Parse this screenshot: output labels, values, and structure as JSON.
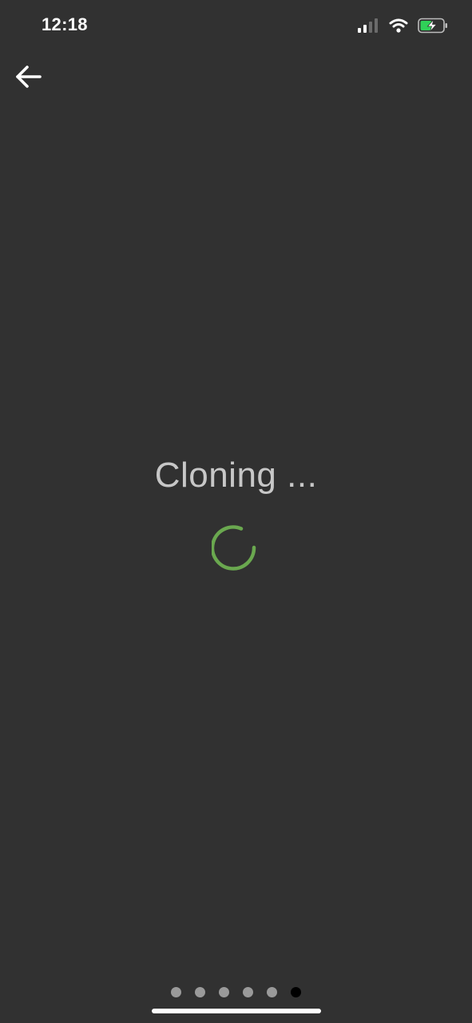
{
  "status_bar": {
    "time": "12:18",
    "icons": [
      "cellular-signal-icon",
      "wifi-icon",
      "battery-charging-icon"
    ],
    "battery_color": "#30d158"
  },
  "nav": {
    "back_icon": "arrow-left-icon"
  },
  "loading": {
    "title": "Cloning ...",
    "spinner_color": "#6aa84f"
  },
  "pager": {
    "count": 6,
    "active_index": 5
  },
  "colors": {
    "background": "#313131",
    "title_text": "#c7c7c7",
    "dot_inactive": "#9a9a9a",
    "dot_active": "#000000"
  }
}
